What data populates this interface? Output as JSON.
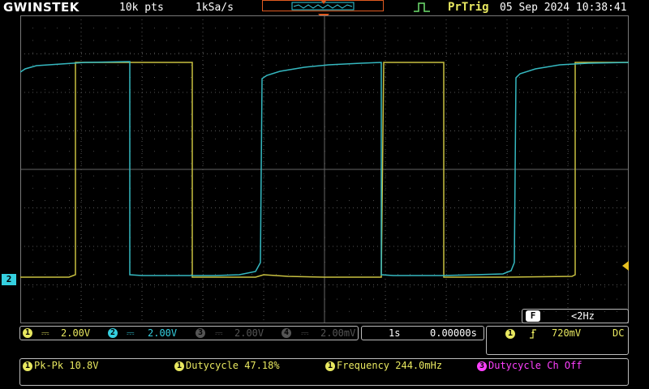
{
  "header": {
    "brand": "GWINSTEK",
    "record_length": "10k pts",
    "sample_rate": "1kSa/s",
    "trigger_status": "PrTrig",
    "datetime": "05 Sep 2024 10:38:41"
  },
  "channels": [
    {
      "num": "1",
      "coupling": "⎓",
      "scale": "2.00V",
      "color": "#e8e860",
      "active": true
    },
    {
      "num": "2",
      "coupling": "⎓",
      "scale": "2.00V",
      "color": "#35d0e0",
      "active": true
    },
    {
      "num": "3",
      "coupling": "⎓",
      "scale": "2.00V",
      "color": "#555555",
      "active": false
    },
    {
      "num": "4",
      "coupling": "⎓",
      "scale": "2.00mV",
      "color": "#555555",
      "active": false
    }
  ],
  "ch2_marker": "2",
  "timebase": {
    "scale": "1s",
    "position": "0.00000s"
  },
  "trigger": {
    "source": "1",
    "slope_icon": "rising-edge-icon",
    "level": "720mV",
    "coupling": "DC"
  },
  "filter": {
    "label": "F",
    "value": "<2Hz"
  },
  "measurements": [
    {
      "source": "1",
      "text": "Pk-Pk 10.8V",
      "color": "#e8e860"
    },
    {
      "source": "1",
      "text": "Dutycycle 47.18%",
      "color": "#e8e860"
    },
    {
      "source": "1",
      "text": "Frequency 244.0mHz",
      "color": "#e8e860"
    },
    {
      "source": "3",
      "text": "Dutycycle Ch Off",
      "color": "#ff40ff"
    }
  ],
  "colors": {
    "ch1": "#e8e860",
    "ch2": "#35d0e0",
    "grid": "#555555",
    "accent": "#e05a20"
  }
}
